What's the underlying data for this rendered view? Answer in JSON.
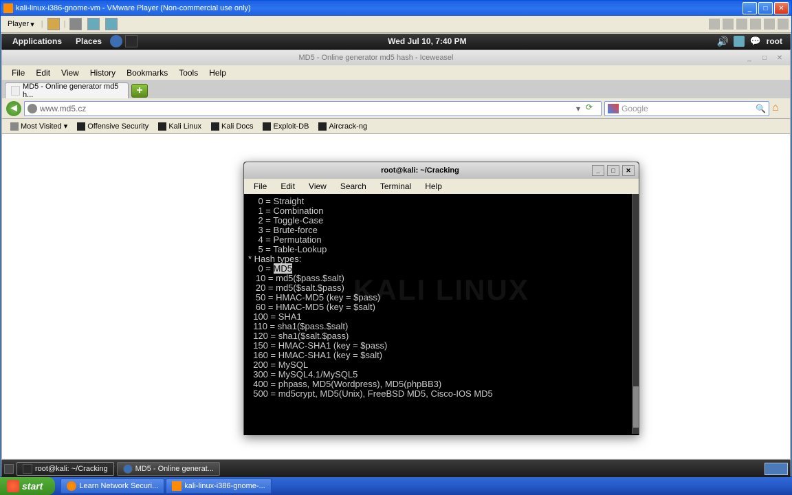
{
  "vmware": {
    "title": "kali-linux-i386-gnome-vm - VMware Player (Non-commercial use only)",
    "player_menu": "Player",
    "dropdown": "▾"
  },
  "kali": {
    "applications": "Applications",
    "places": "Places",
    "datetime": "Wed Jul 10,  7:40 PM",
    "user": "root"
  },
  "firefox": {
    "title_inactive": "MD5 - Online generator md5 hash - Iceweasel",
    "menu": {
      "file": "File",
      "edit": "Edit",
      "view": "View",
      "history": "History",
      "bookmarks": "Bookmarks",
      "tools": "Tools",
      "help": "Help"
    },
    "tab": "MD5 - Online generator md5 h...",
    "newtab_glyph": "+",
    "back_glyph": "◄",
    "url": "www.md5.cz",
    "url_drop": "▾",
    "reload_glyph": "⟳",
    "search_placeholder": "Google",
    "search_glass": "🔍",
    "home_glyph": "⌂",
    "bookmarks": {
      "most_visited": "Most Visited",
      "mv_drop": "▾",
      "offensive": "Offensive Security",
      "kali": "Kali Linux",
      "docs": "Kali Docs",
      "exploitdb": "Exploit-DB",
      "aircrack": "Aircrack-ng"
    },
    "win": {
      "min": "_",
      "max": "□",
      "close": "✕"
    }
  },
  "terminal": {
    "title": "root@kali: ~/Cracking",
    "menu": {
      "file": "File",
      "edit": "Edit",
      "view": "View",
      "search": "Search",
      "terminal": "Terminal",
      "help": "Help"
    },
    "win": {
      "min": "_",
      "max": "□",
      "close": "✕"
    },
    "watermark": "KALI LINUX",
    "lines": [
      "    0 = Straight",
      "    1 = Combination",
      "    2 = Toggle-Case",
      "    3 = Brute-force",
      "    4 = Permutation",
      "    5 = Table-Lookup",
      "",
      "* Hash types:",
      "",
      "    0 = MD5",
      "   10 = md5($pass.$salt)",
      "   20 = md5($salt.$pass)",
      "   50 = HMAC-MD5 (key = $pass)",
      "   60 = HMAC-MD5 (key = $salt)",
      "  100 = SHA1",
      "  110 = sha1($pass.$salt)",
      "  120 = sha1($salt.$pass)",
      "  150 = HMAC-SHA1 (key = $pass)",
      "  160 = HMAC-SHA1 (key = $salt)",
      "  200 = MySQL",
      "  300 = MySQL4.1/MySQL5",
      "  400 = phpass, MD5(Wordpress), MD5(phpBB3)",
      "  500 = md5crypt, MD5(Unix), FreeBSD MD5, Cisco-IOS MD5"
    ],
    "highlight_line_index": 9,
    "highlight_text": "MD5"
  },
  "kali_panel": {
    "task1": "root@kali: ~/Cracking",
    "task2": "MD5 - Online generat..."
  },
  "xp": {
    "start": "start",
    "task1": "Learn Network Securi...",
    "task2": "kali-linux-i386-gnome-..."
  }
}
